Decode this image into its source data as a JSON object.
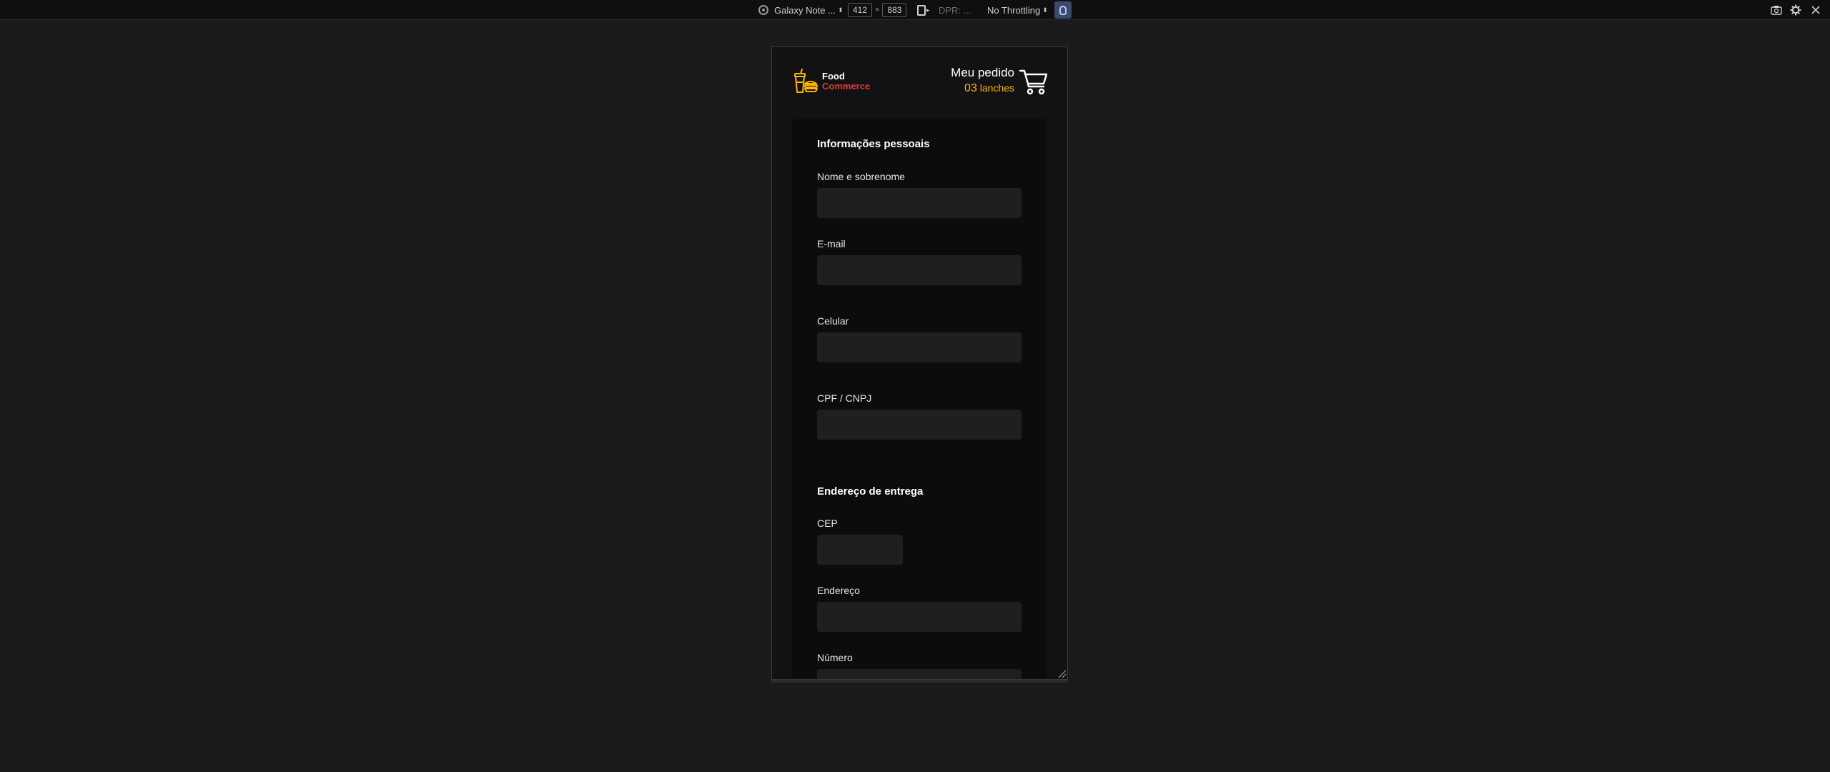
{
  "devtools": {
    "device_name": "Galaxy Note ...",
    "width": "412",
    "times": "×",
    "height": "883",
    "dpr": "DPR: ...",
    "throttling": "No Throttling"
  },
  "app": {
    "logo": {
      "line1": "Food",
      "line2": "Commerce"
    },
    "order": {
      "title": "Meu pedido",
      "count": "03",
      "unit": "lanches"
    }
  },
  "form": {
    "personal": {
      "title": "Informações pessoais",
      "name_label": "Nome e sobrenome",
      "email_label": "E-mail",
      "phone_label": "Celular",
      "document_label": "CPF / CNPJ"
    },
    "delivery": {
      "title": "Endereço de entrega",
      "zip_label": "CEP",
      "address_label": "Endereço",
      "number_label": "Número"
    }
  },
  "colors": {
    "accent_yellow": "#ffb300",
    "accent_red": "#e53935",
    "background": "#1a1a1c",
    "card": "#0c0c0d",
    "input": "#1f1f22"
  }
}
